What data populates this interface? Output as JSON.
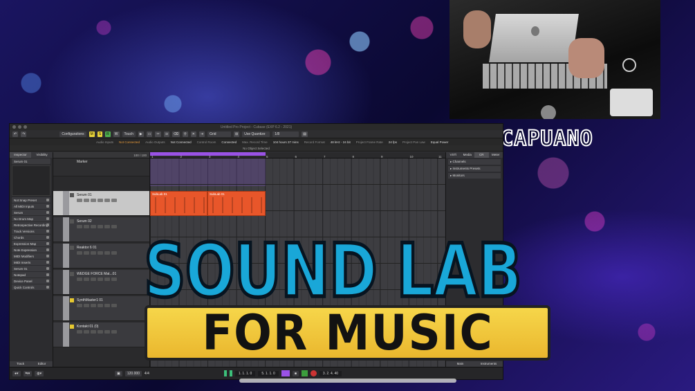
{
  "presenter": {
    "name": "DOM CAPUANO"
  },
  "overlay": {
    "line1": "SOUND LAB",
    "line2": "FOR MUSIC"
  },
  "daw": {
    "window_title": "Untitled Pro Project - Cubase (EXP 6.2 - 2021)",
    "toolbar": {
      "configurations": "Configurations",
      "m": "M",
      "s": "S",
      "r": "R",
      "w": "W",
      "automation_mode": "Touch",
      "grid_type": "Grid",
      "quantize": "Use Quantize",
      "quantize_value": "1/8"
    },
    "info": [
      {
        "label": "Audio Inputs",
        "value": "Not Connected",
        "warn": true
      },
      {
        "label": "Audio Outputs",
        "value": "Not Connected",
        "warn": false
      },
      {
        "label": "Control Room",
        "value": "Connected",
        "warn": false
      },
      {
        "label": "Max. Record Time",
        "value": "104 hours 37 mins",
        "warn": false
      },
      {
        "label": "Record Format",
        "value": "48 kHz - 24 bit",
        "warn": false
      },
      {
        "label": "Project Frame Rate",
        "value": "24 fps",
        "warn": false
      },
      {
        "label": "Project Pan Law",
        "value": "Equal Power",
        "warn": false
      }
    ],
    "status": "No Object Selected",
    "inspector": {
      "tabs": [
        "Inspector",
        "Visibility"
      ],
      "track_name": "Serum 01",
      "rows": [
        "Not Snap Preset",
        "All MIDI Inputs",
        "Serum",
        "No Drum Map",
        "Retrospective Recording",
        "Track Versions",
        "Chords",
        "Expression Map",
        "Note Expression",
        "MIDI Modifiers",
        "MIDI Inserts",
        "Serum 01",
        "Notepad",
        "Device Panel",
        "Quick Controls"
      ],
      "bottom_tabs": [
        "Track",
        "Editor"
      ]
    },
    "tracklist": {
      "header_count": "100 / 100",
      "marker_label": "Marker",
      "tracks": [
        {
          "name": "Serum 01",
          "selected": true
        },
        {
          "name": "Serum 02",
          "selected": false
        },
        {
          "name": "Reaktor 6 01",
          "selected": false
        },
        {
          "name": "WEDGE FORCE Mat...01",
          "selected": false
        },
        {
          "name": "SynthMaster1 01",
          "selected": false
        },
        {
          "name": "Kontakt 01 (0)",
          "selected": false
        }
      ]
    },
    "ruler_ticks": [
      "1",
      "2",
      "3",
      "4",
      "5",
      "6",
      "7",
      "8",
      "9",
      "10",
      "11"
    ],
    "clips": [
      {
        "title": "SubLab 01"
      },
      {
        "title": "SubLab 01"
      }
    ],
    "rightpanel": {
      "tabs": [
        "VSTi",
        "Media",
        "CR",
        "Meter"
      ],
      "items": [
        "Channels",
        "Instruments Presets",
        "Monitors"
      ],
      "bottom_tabs": [
        "Main",
        "Instruments"
      ]
    },
    "transport": {
      "tempo": "120.000",
      "signature": "4/4",
      "left_locator": "1. 1. 1. 0",
      "right_locator": "5. 1. 1. 0",
      "position": "3. 2. 4. 40"
    },
    "colors": {
      "clip": "#e8562a",
      "loop": "#9a52e6",
      "accent_yellow": "#e8d33a"
    }
  }
}
